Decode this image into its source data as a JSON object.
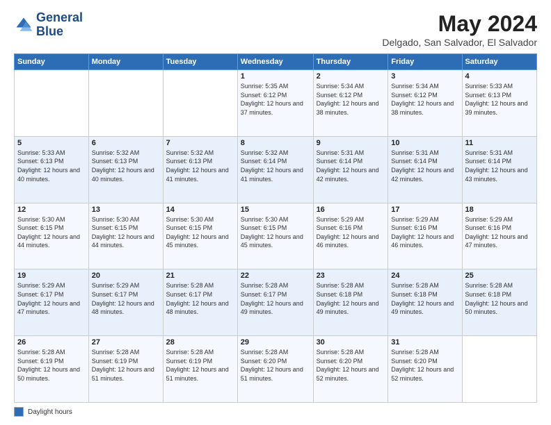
{
  "header": {
    "logo_line1": "General",
    "logo_line2": "Blue",
    "month_title": "May 2024",
    "location": "Delgado, San Salvador, El Salvador"
  },
  "days_of_week": [
    "Sunday",
    "Monday",
    "Tuesday",
    "Wednesday",
    "Thursday",
    "Friday",
    "Saturday"
  ],
  "weeks": [
    [
      {
        "day": "",
        "info": ""
      },
      {
        "day": "",
        "info": ""
      },
      {
        "day": "",
        "info": ""
      },
      {
        "day": "1",
        "info": "Sunrise: 5:35 AM\nSunset: 6:12 PM\nDaylight: 12 hours\nand 37 minutes."
      },
      {
        "day": "2",
        "info": "Sunrise: 5:34 AM\nSunset: 6:12 PM\nDaylight: 12 hours\nand 38 minutes."
      },
      {
        "day": "3",
        "info": "Sunrise: 5:34 AM\nSunset: 6:12 PM\nDaylight: 12 hours\nand 38 minutes."
      },
      {
        "day": "4",
        "info": "Sunrise: 5:33 AM\nSunset: 6:13 PM\nDaylight: 12 hours\nand 39 minutes."
      }
    ],
    [
      {
        "day": "5",
        "info": "Sunrise: 5:33 AM\nSunset: 6:13 PM\nDaylight: 12 hours\nand 40 minutes."
      },
      {
        "day": "6",
        "info": "Sunrise: 5:32 AM\nSunset: 6:13 PM\nDaylight: 12 hours\nand 40 minutes."
      },
      {
        "day": "7",
        "info": "Sunrise: 5:32 AM\nSunset: 6:13 PM\nDaylight: 12 hours\nand 41 minutes."
      },
      {
        "day": "8",
        "info": "Sunrise: 5:32 AM\nSunset: 6:14 PM\nDaylight: 12 hours\nand 41 minutes."
      },
      {
        "day": "9",
        "info": "Sunrise: 5:31 AM\nSunset: 6:14 PM\nDaylight: 12 hours\nand 42 minutes."
      },
      {
        "day": "10",
        "info": "Sunrise: 5:31 AM\nSunset: 6:14 PM\nDaylight: 12 hours\nand 42 minutes."
      },
      {
        "day": "11",
        "info": "Sunrise: 5:31 AM\nSunset: 6:14 PM\nDaylight: 12 hours\nand 43 minutes."
      }
    ],
    [
      {
        "day": "12",
        "info": "Sunrise: 5:30 AM\nSunset: 6:15 PM\nDaylight: 12 hours\nand 44 minutes."
      },
      {
        "day": "13",
        "info": "Sunrise: 5:30 AM\nSunset: 6:15 PM\nDaylight: 12 hours\nand 44 minutes."
      },
      {
        "day": "14",
        "info": "Sunrise: 5:30 AM\nSunset: 6:15 PM\nDaylight: 12 hours\nand 45 minutes."
      },
      {
        "day": "15",
        "info": "Sunrise: 5:30 AM\nSunset: 6:15 PM\nDaylight: 12 hours\nand 45 minutes."
      },
      {
        "day": "16",
        "info": "Sunrise: 5:29 AM\nSunset: 6:16 PM\nDaylight: 12 hours\nand 46 minutes."
      },
      {
        "day": "17",
        "info": "Sunrise: 5:29 AM\nSunset: 6:16 PM\nDaylight: 12 hours\nand 46 minutes."
      },
      {
        "day": "18",
        "info": "Sunrise: 5:29 AM\nSunset: 6:16 PM\nDaylight: 12 hours\nand 47 minutes."
      }
    ],
    [
      {
        "day": "19",
        "info": "Sunrise: 5:29 AM\nSunset: 6:17 PM\nDaylight: 12 hours\nand 47 minutes."
      },
      {
        "day": "20",
        "info": "Sunrise: 5:29 AM\nSunset: 6:17 PM\nDaylight: 12 hours\nand 48 minutes."
      },
      {
        "day": "21",
        "info": "Sunrise: 5:28 AM\nSunset: 6:17 PM\nDaylight: 12 hours\nand 48 minutes."
      },
      {
        "day": "22",
        "info": "Sunrise: 5:28 AM\nSunset: 6:17 PM\nDaylight: 12 hours\nand 49 minutes."
      },
      {
        "day": "23",
        "info": "Sunrise: 5:28 AM\nSunset: 6:18 PM\nDaylight: 12 hours\nand 49 minutes."
      },
      {
        "day": "24",
        "info": "Sunrise: 5:28 AM\nSunset: 6:18 PM\nDaylight: 12 hours\nand 49 minutes."
      },
      {
        "day": "25",
        "info": "Sunrise: 5:28 AM\nSunset: 6:18 PM\nDaylight: 12 hours\nand 50 minutes."
      }
    ],
    [
      {
        "day": "26",
        "info": "Sunrise: 5:28 AM\nSunset: 6:19 PM\nDaylight: 12 hours\nand 50 minutes."
      },
      {
        "day": "27",
        "info": "Sunrise: 5:28 AM\nSunset: 6:19 PM\nDaylight: 12 hours\nand 51 minutes."
      },
      {
        "day": "28",
        "info": "Sunrise: 5:28 AM\nSunset: 6:19 PM\nDaylight: 12 hours\nand 51 minutes."
      },
      {
        "day": "29",
        "info": "Sunrise: 5:28 AM\nSunset: 6:20 PM\nDaylight: 12 hours\nand 51 minutes."
      },
      {
        "day": "30",
        "info": "Sunrise: 5:28 AM\nSunset: 6:20 PM\nDaylight: 12 hours\nand 52 minutes."
      },
      {
        "day": "31",
        "info": "Sunrise: 5:28 AM\nSunset: 6:20 PM\nDaylight: 12 hours\nand 52 minutes."
      },
      {
        "day": "",
        "info": ""
      }
    ]
  ],
  "footer": {
    "legend_label": "Daylight hours"
  }
}
